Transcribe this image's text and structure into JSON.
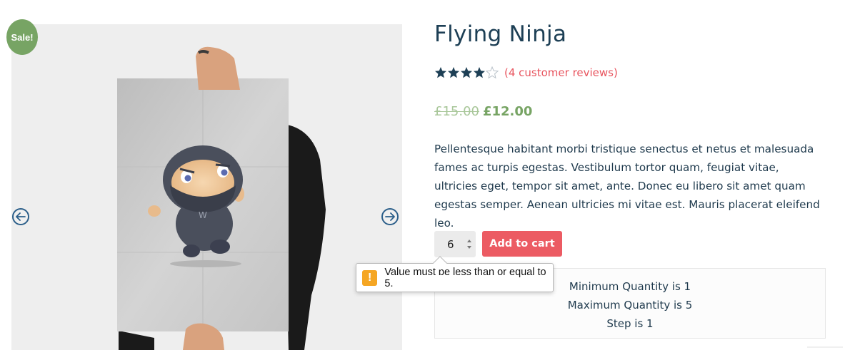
{
  "product": {
    "sale_badge": "Sale!",
    "title": "Flying Ninja",
    "rating": {
      "value": 4,
      "max": 5,
      "review_link": "(4 customer reviews)"
    },
    "price": {
      "old": "£15.00",
      "current": "£12.00"
    },
    "description": "Pellentesque habitant morbi tristique senectus et netus et malesuada fames ac turpis egestas. Vestibulum tortor quam, feugiat vitae, ultricies eget, tempor sit amet, ante. Donec eu libero sit amet quam egestas semper. Aenean ultricies mi vitae est. Mauris placerat eleifend leo."
  },
  "cart_form": {
    "quantity_value": "6",
    "add_to_cart_label": "Add to cart"
  },
  "quantity_rules": {
    "min": "Minimum Quantity is 1",
    "max": "Maximum Quantity is 5",
    "step": "Step is 1"
  },
  "validation_tooltip": {
    "icon": "!",
    "message": "Value must be less than or equal to 5."
  },
  "gallery": {
    "prev_icon": "arrow-left-icon",
    "next_icon": "arrow-right-icon"
  },
  "colors": {
    "sale_green": "#77a464",
    "accent_red": "#ec5b63",
    "link_red": "#e8555f",
    "heading": "#1d3f55",
    "star": "#1d3f55",
    "warning": "#f5a623"
  }
}
